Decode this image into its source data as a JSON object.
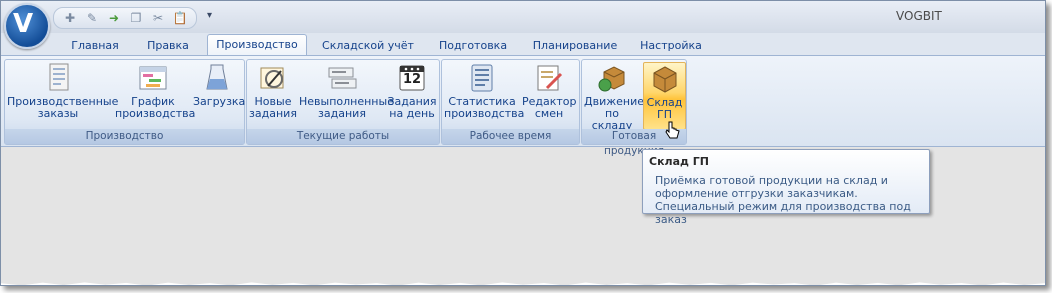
{
  "window": {
    "title": "VOGBIT"
  },
  "quick_access": {
    "icons": [
      "add-record-icon",
      "edit-icon",
      "exit-icon",
      "copy-icon",
      "cut-icon",
      "paste-icon"
    ],
    "more": "▾"
  },
  "tabs": [
    {
      "label": "Главная"
    },
    {
      "label": "Правка"
    },
    {
      "label": "Производство",
      "active": true
    },
    {
      "label": "Складской учёт"
    },
    {
      "label": "Подготовка"
    },
    {
      "label": "Планирование"
    },
    {
      "label": "Настройка"
    }
  ],
  "groups": [
    {
      "label": "Производство",
      "buttons": [
        {
          "line1": "Производственные",
          "line2": "заказы",
          "icon": "orders-icon"
        },
        {
          "line1": "График",
          "line2": "производства",
          "icon": "schedule-grid-icon"
        },
        {
          "line1": "Загрузка",
          "line2": "",
          "icon": "load-beaker-icon"
        }
      ]
    },
    {
      "label": "Текущие работы",
      "buttons": [
        {
          "line1": "Новые",
          "line2": "задания",
          "icon": "new-task-icon"
        },
        {
          "line1": "Невыполненные",
          "line2": "задания",
          "icon": "pending-tasks-icon"
        },
        {
          "line1": "Задания",
          "line2": "на день",
          "icon": "calendar-icon",
          "calendar_day": "12"
        }
      ]
    },
    {
      "label": "Рабочее время",
      "buttons": [
        {
          "line1": "Статистика",
          "line2": "производства",
          "icon": "statistics-icon"
        },
        {
          "line1": "Редактор",
          "line2": "смен",
          "icon": "shift-editor-icon"
        }
      ]
    },
    {
      "label": "Готовая продукция",
      "buttons": [
        {
          "line1": "Движение",
          "line2": "по складу",
          "icon": "warehouse-move-icon"
        },
        {
          "line1": "Склад",
          "line2": "ГП",
          "icon": "warehouse-box-icon",
          "hover": true
        }
      ]
    }
  ],
  "tooltip": {
    "title": "Склад ГП",
    "body": "Приёмка готовой продукции на склад и оформление отгрузки заказчикам. Специальный режим для производства под заказ"
  },
  "colors": {
    "accent": "#15428b",
    "hover": "#ffd66b",
    "ribbon": "#dae4f1"
  }
}
